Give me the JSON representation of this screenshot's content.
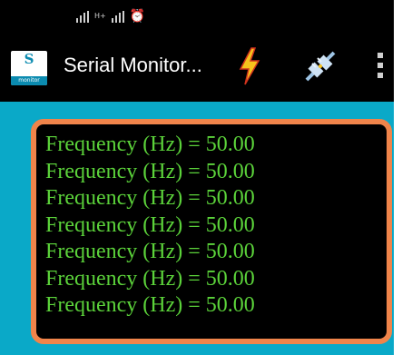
{
  "status_bar": {
    "network_label": "H+",
    "icons": [
      "signal-bars-icon",
      "signal-bars-icon",
      "alarm-clock-icon"
    ]
  },
  "toolbar": {
    "app_icon_letter": "S",
    "app_icon_caption": "monitor",
    "title": "Serial Monitor...",
    "actions": [
      "lightning-bolt-icon",
      "plug-disconnected-icon",
      "overflow-menu-icon"
    ]
  },
  "monitor": {
    "lines": [
      "Frequency (Hz) = 50.00",
      "Frequency (Hz) = 50.00",
      "Frequency (Hz) = 50.00",
      "Frequency (Hz) = 50.00",
      "Frequency (Hz) = 50.00",
      "Frequency (Hz) = 50.00",
      "Frequency (Hz) = 50.00"
    ]
  },
  "colors": {
    "background": "#0aa9c8",
    "bar_background": "#000000",
    "monitor_border": "#f0844a",
    "monitor_text": "#5bd23a"
  }
}
